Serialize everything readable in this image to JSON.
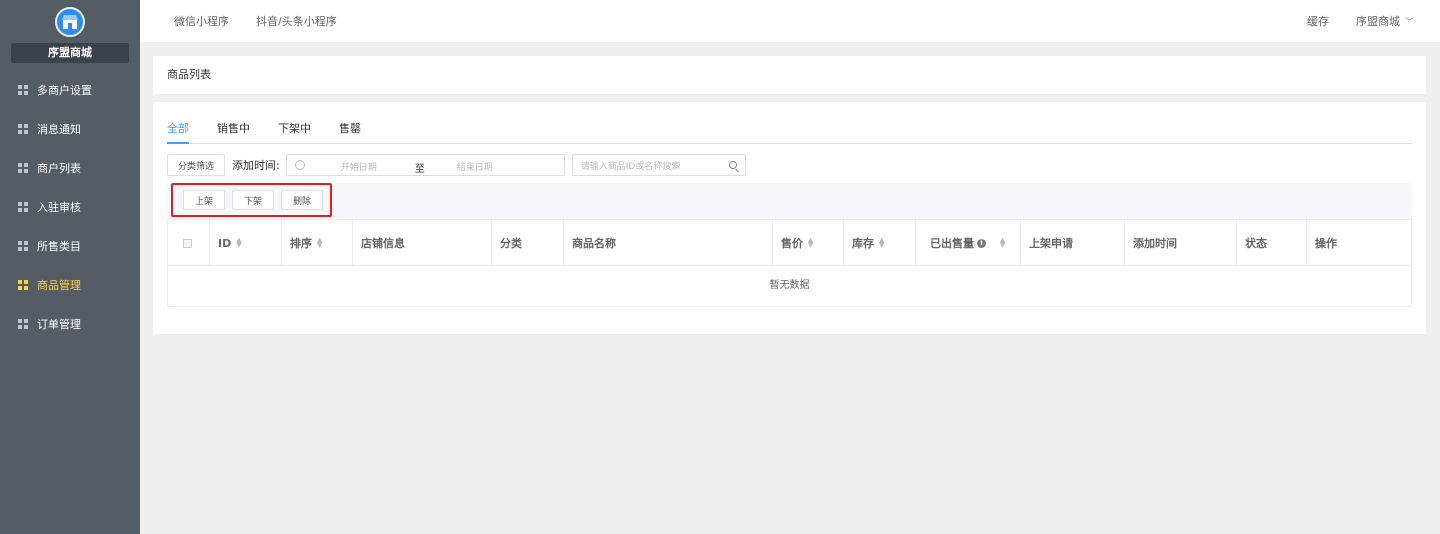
{
  "sidebar": {
    "brand": "序盟商城",
    "items": [
      {
        "label": "多商户设置"
      },
      {
        "label": "消息通知"
      },
      {
        "label": "商户列表"
      },
      {
        "label": "入驻审核"
      },
      {
        "label": "所售类目"
      },
      {
        "label": "商品管理",
        "active": true
      },
      {
        "label": "订单管理"
      }
    ],
    "active_color": "#ffd04b",
    "bg_color": "#545c64"
  },
  "topbar": {
    "tabs": [
      "微信小程序",
      "抖音/头条小程序"
    ],
    "cache_label": "缓存",
    "user_label": "序盟商城"
  },
  "breadcrumb": "商品列表",
  "tabs": [
    "全部",
    "销售中",
    "下架中",
    "售罄"
  ],
  "filter": {
    "category_button": "分类筛选",
    "date_label": "添加时间:",
    "start_placeholder": "开始日期",
    "separator": "至",
    "end_placeholder": "结束日期",
    "search_placeholder": "请输入商品ID或名称搜索"
  },
  "actions": [
    "上架",
    "下架",
    "删除"
  ],
  "table": {
    "columns": [
      "ID",
      "排序",
      "店铺信息",
      "分类",
      "商品名称",
      "售价",
      "库存",
      "已出售量",
      "上架申请",
      "添加时间",
      "状态",
      "操作"
    ],
    "empty_text": "暂无数据"
  },
  "accent_color": "#409eff",
  "highlight_color": "#e02020"
}
